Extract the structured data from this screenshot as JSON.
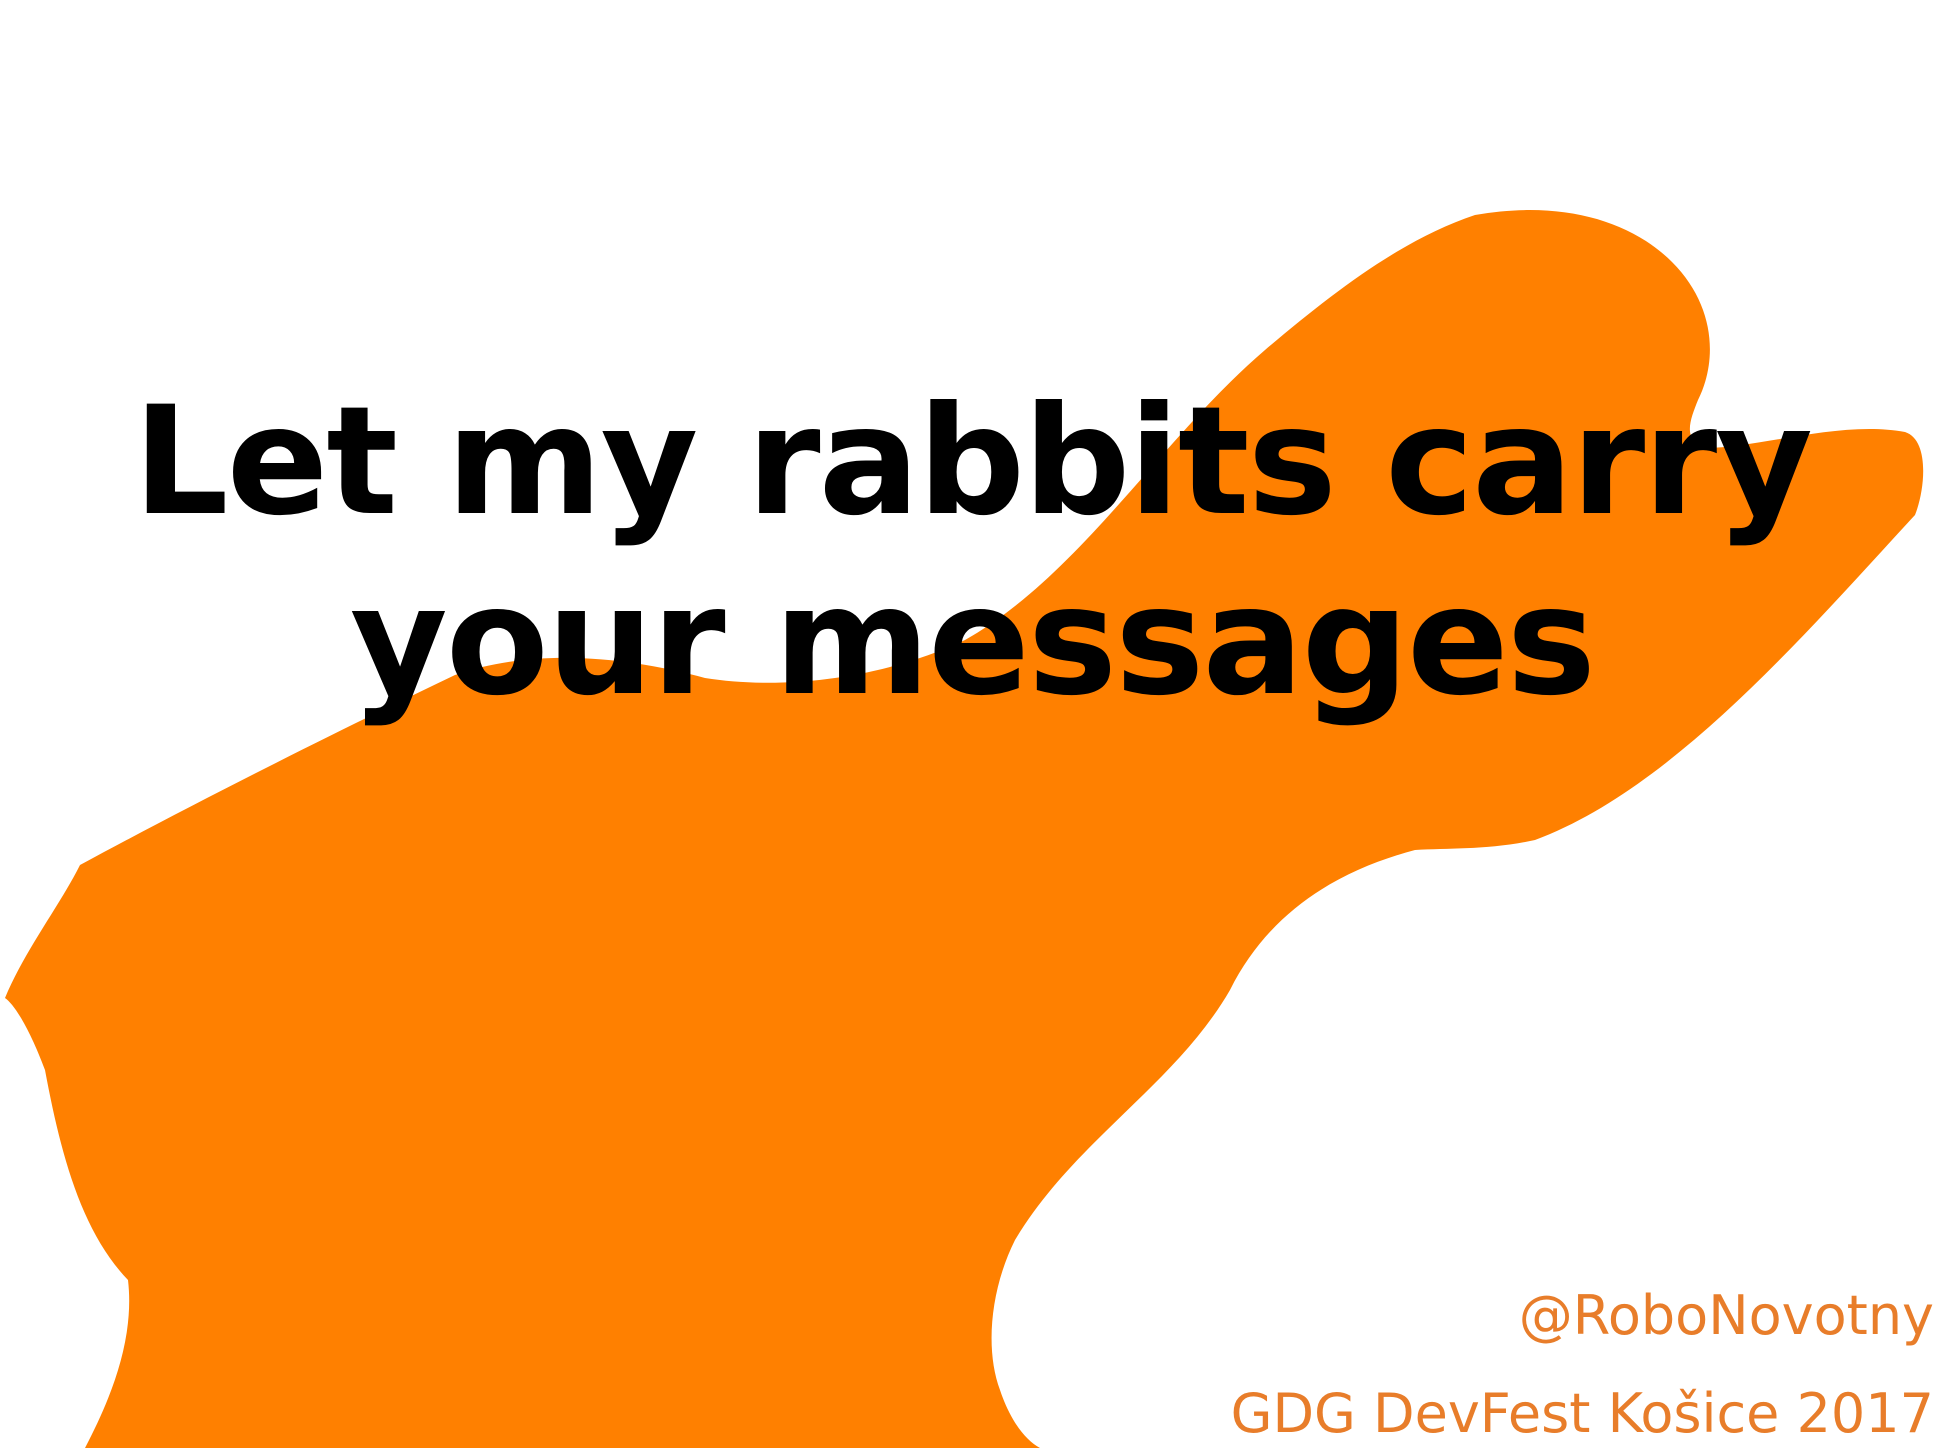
{
  "slide": {
    "title_line1": "Let my rabbits carry",
    "title_line2": "your messages",
    "handle": "@RoboNovotny",
    "event": "GDG DevFest Košice 2017"
  },
  "colors": {
    "background": "#ffffff",
    "rabbit_fill": "#ff8000",
    "title_text": "#000000",
    "footer_text": "#e87d2a"
  },
  "icons": {
    "rabbit": "rabbit-silhouette-icon"
  }
}
